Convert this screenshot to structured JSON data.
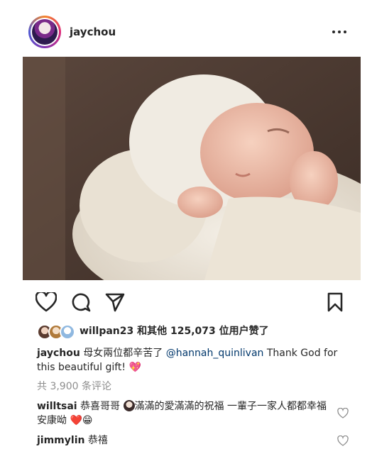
{
  "post": {
    "username": "jaychou",
    "more_label": "•••"
  },
  "likes": {
    "liker": "willpan23",
    "text_mid": " 和其他 ",
    "count": "125,073",
    "text_end": " 位用户赞了"
  },
  "caption": {
    "username": "jaychou",
    "text": " 母女兩位都辛苦了 ",
    "mention": "@hannah_quinlivan",
    "text2": "  Thank God for this beautiful gift! ",
    "emoji": "💖"
  },
  "comments_link": "共 3,900 条评论",
  "comments": [
    {
      "username": "willtsai",
      "text1": " 恭喜哥哥 ",
      "text2": "滿滿的愛滿滿的祝福  一輩子一家人都都幸福安康呦 ",
      "emoji": "❤️😁"
    },
    {
      "username": "jimmylin",
      "text1": " 恭禧"
    }
  ],
  "icons": {
    "like": "heart-icon",
    "comment": "comment-icon",
    "share": "send-icon",
    "save": "bookmark-icon",
    "comment_like": "heart-icon"
  },
  "colors": {
    "text": "#262626",
    "muted": "#8e8e8e",
    "mention": "#00376b"
  }
}
